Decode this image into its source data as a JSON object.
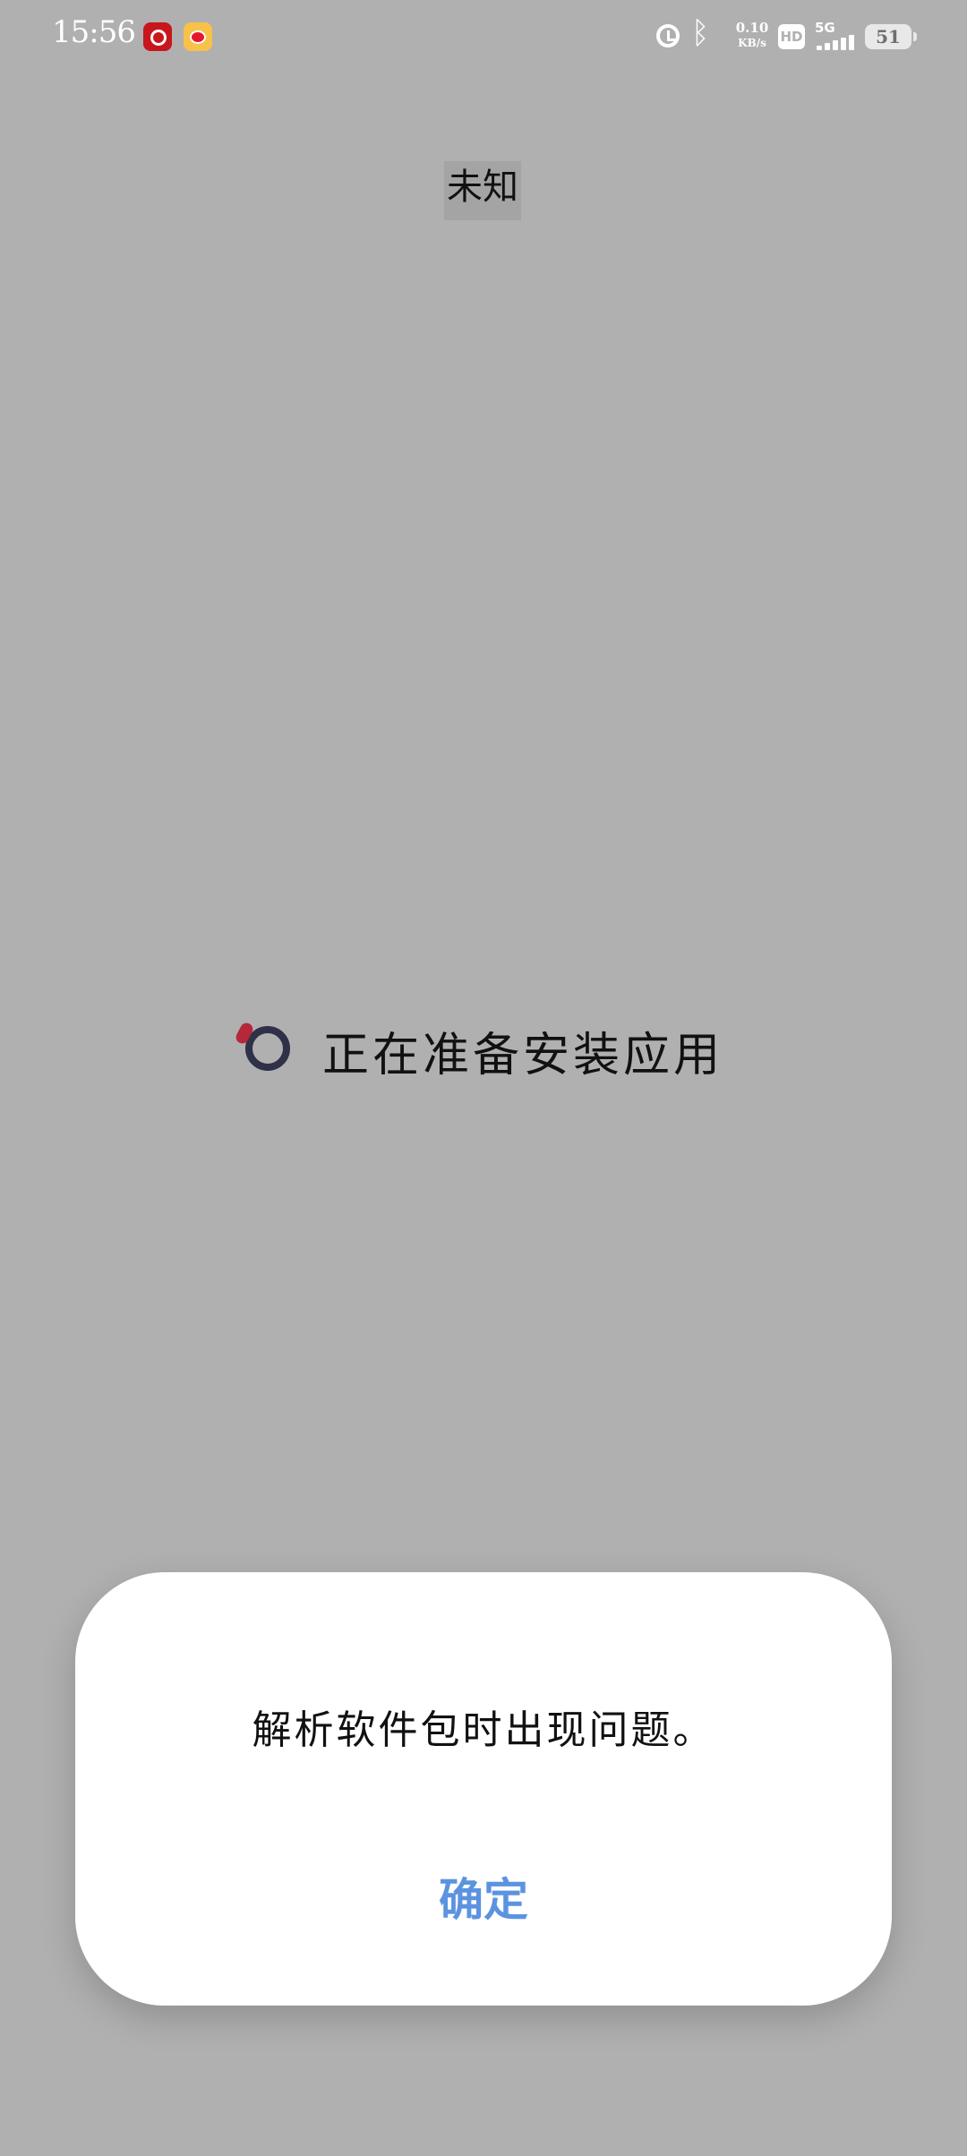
{
  "status_bar": {
    "time": "15:56",
    "notifications": [
      "netease-music-icon",
      "weibo-icon"
    ],
    "net_speed_value": "0.10",
    "net_speed_unit": "KB/s",
    "hd_label": "HD",
    "network_label": "5G",
    "battery_level": "51",
    "icons": [
      "alarm-icon",
      "bluetooth-icon",
      "signal-icon",
      "battery-icon"
    ]
  },
  "page": {
    "app_name": "未知",
    "progress_text": "正在准备安装应用"
  },
  "dialog": {
    "message": "解析软件包时出现问题。",
    "confirm_label": "确定"
  },
  "colors": {
    "background": "#b0b0b0",
    "dialog_background": "#ffffff",
    "accent": "#5b93e0",
    "spinner_ring": "#2e3148",
    "spinner_dot": "#b4283a"
  }
}
